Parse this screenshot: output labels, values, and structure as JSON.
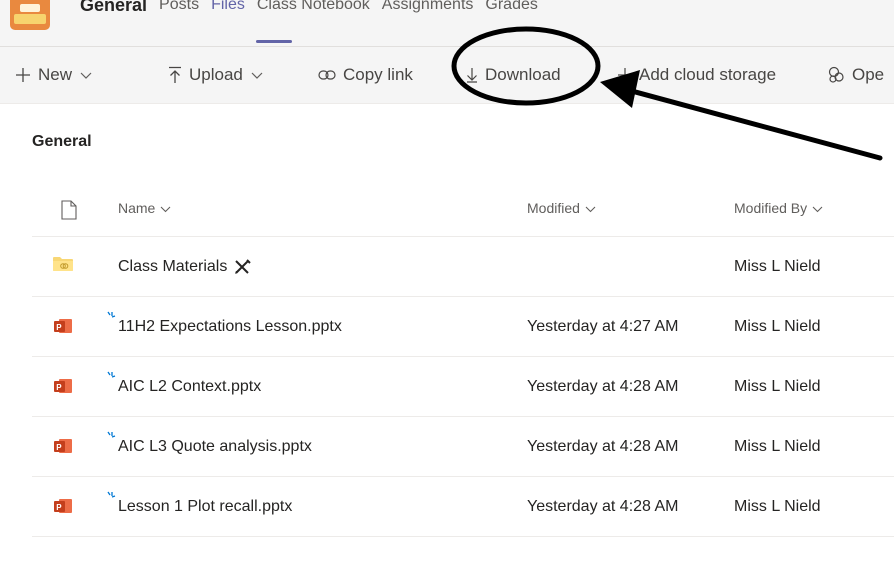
{
  "header": {
    "tabs": [
      {
        "label": "General",
        "kind": "channel"
      },
      {
        "label": "Posts"
      },
      {
        "label": "Files",
        "active": true
      },
      {
        "label": "Class Notebook"
      },
      {
        "label": "Assignments"
      },
      {
        "label": "Grades"
      }
    ]
  },
  "toolbar": {
    "new_label": "New",
    "upload_label": "Upload",
    "copy_link_label": "Copy link",
    "download_label": "Download",
    "add_cloud_label": "Add cloud storage",
    "open_label": "Ope"
  },
  "main": {
    "section_title": "General",
    "columns": {
      "name": "Name",
      "modified": "Modified",
      "modified_by": "Modified By"
    },
    "rows": [
      {
        "type": "folder",
        "name": "Class Materials",
        "modified": "",
        "modified_by": "Miss L Nield"
      },
      {
        "type": "pptx",
        "name": "11H2 Expectations Lesson.pptx",
        "modified": "Yesterday at 4:27 AM",
        "modified_by": "Miss L Nield"
      },
      {
        "type": "pptx",
        "name": "AIC L2 Context.pptx",
        "modified": "Yesterday at 4:28 AM",
        "modified_by": "Miss L Nield"
      },
      {
        "type": "pptx",
        "name": "AIC L3 Quote analysis.pptx",
        "modified": "Yesterday at 4:28 AM",
        "modified_by": "Miss L Nield"
      },
      {
        "type": "pptx",
        "name": "Lesson 1 Plot recall.pptx",
        "modified": "Yesterday at 4:28 AM",
        "modified_by": "Miss L Nield"
      }
    ]
  },
  "colors": {
    "accent": "#6264a7",
    "ppt": "#d35230",
    "folder": "#f8d775",
    "new_marker": "#0078d4"
  }
}
